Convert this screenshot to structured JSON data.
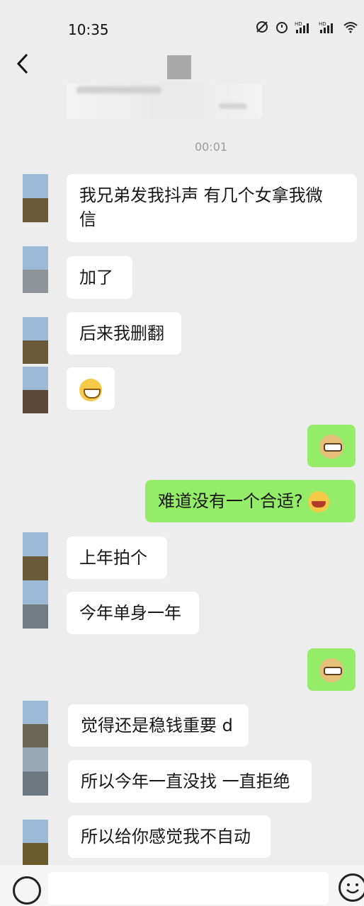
{
  "status_bar": {
    "time": "10:35",
    "icons": [
      "alarm-off-icon",
      "alarm-icon",
      "hd-signal-icon",
      "hd-signal-icon",
      "wifi-icon"
    ]
  },
  "nav": {
    "back_icon": "chevron-left-icon"
  },
  "timestamp": "00:01",
  "messages": [
    {
      "side": "left",
      "text": "我兄弟发我抖声 有几个女拿我微\n信"
    },
    {
      "side": "left",
      "text": "加了"
    },
    {
      "side": "left",
      "text": "后来我删翻"
    },
    {
      "side": "left",
      "emoji": "grin-emoji"
    },
    {
      "side": "right",
      "emoji": "doge-emoji"
    },
    {
      "side": "right",
      "text": "难道没有一个合适?",
      "emoji": "laugh-emoji"
    },
    {
      "side": "left",
      "text": "上年拍个"
    },
    {
      "side": "left",
      "text": "今年单身一年"
    },
    {
      "side": "right",
      "emoji": "doge-emoji"
    },
    {
      "side": "left",
      "text": "觉得还是稳钱重要 d"
    },
    {
      "side": "left",
      "text": "所以今年一直没找 一直拒绝"
    },
    {
      "side": "left",
      "text": "所以给你感觉我不自动"
    }
  ],
  "input": {
    "placeholder": ""
  },
  "colors": {
    "background": "#ededed",
    "self_bubble": "#95ec69",
    "other_bubble": "#ffffff"
  }
}
